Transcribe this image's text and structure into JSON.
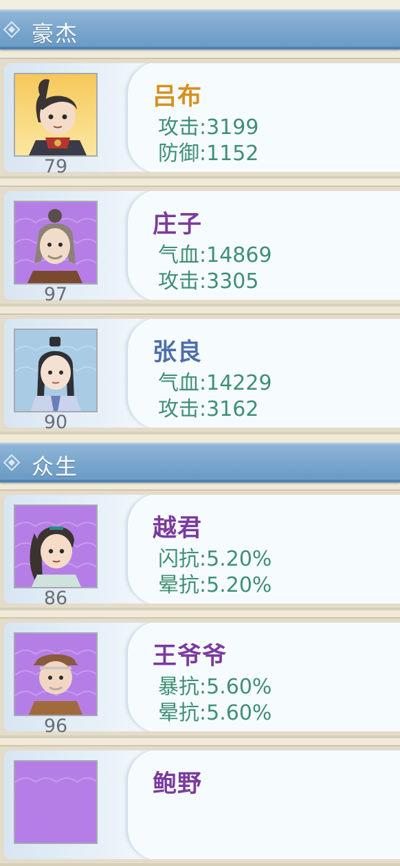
{
  "sections": [
    {
      "title": "豪杰"
    },
    {
      "title": "众生"
    }
  ],
  "heroes": [
    {
      "name": "吕布",
      "name_color": "#d7901e",
      "level": "79",
      "stat1": "攻击:3199",
      "stat2": "防御:1152",
      "avatar_theme": "gold"
    },
    {
      "name": "庄子",
      "name_color": "#7b3b9e",
      "level": "97",
      "stat1": "气血:14869",
      "stat2": "攻击:3305",
      "avatar_theme": "purple"
    },
    {
      "name": "张良",
      "name_color": "#4d6fa8",
      "level": "90",
      "stat1": "气血:14229",
      "stat2": "攻击:3162",
      "avatar_theme": "blue"
    },
    {
      "name": "越君",
      "name_color": "#7b3b9e",
      "level": "86",
      "stat1": "闪抗:5.20%",
      "stat2": "晕抗:5.20%",
      "avatar_theme": "purple"
    },
    {
      "name": "王爷爷",
      "name_color": "#7b3b9e",
      "level": "96",
      "stat1": "暴抗:5.60%",
      "stat2": "晕抗:5.60%",
      "avatar_theme": "purple"
    },
    {
      "name": "鲍野",
      "name_color": "#7b3b9e",
      "avatar_theme": "purple"
    }
  ],
  "colors": {
    "gold": "#f6c85a",
    "purple": "#b57ee6",
    "blue": "#a9cbe4",
    "stat": "#3f8f73"
  }
}
